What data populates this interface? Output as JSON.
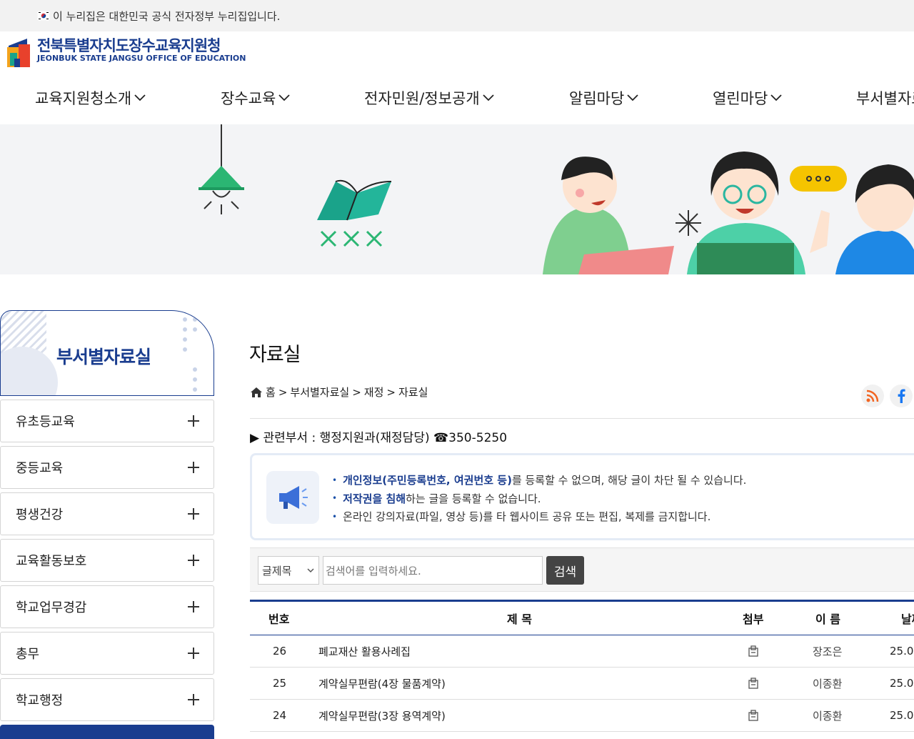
{
  "gov_bar": {
    "text": "이 누리집은 대한민국 공식 전자정부 누리집입니다."
  },
  "logo": {
    "name_ko": "전북특별자치도장수교육지원청",
    "name_en": "JEONBUK STATE JANGSU OFFICE OF EDUCATION"
  },
  "gnb": [
    {
      "label": "교육지원청소개"
    },
    {
      "label": "장수교육"
    },
    {
      "label": "전자민원/정보공개"
    },
    {
      "label": "알림마당"
    },
    {
      "label": "열린마당"
    },
    {
      "label": "부서별자료실"
    }
  ],
  "sidebar": {
    "title": "부서별자료실",
    "items": [
      {
        "label": "유초등교육"
      },
      {
        "label": "중등교육"
      },
      {
        "label": "평생건강"
      },
      {
        "label": "교육활동보호"
      },
      {
        "label": "학교업무경감"
      },
      {
        "label": "총무"
      },
      {
        "label": "학교행정"
      }
    ]
  },
  "content": {
    "title": "자료실",
    "breadcrumb": {
      "home": "홈",
      "level1": "부서별자료실",
      "level2": "재정",
      "current": "자료실",
      "sep": ">"
    },
    "dept": "▶ 관련부서 : 행정지원과(재정담당) ☎350-5250"
  },
  "notice": {
    "line1_strong": "개인정보(주민등록번호, 여권번호 등)",
    "line1_rest": "를 등록할 수 없으며, 해당 글이 차단 될 수 있습니다.",
    "line2_strong": "저작권을 침해",
    "line2_rest": "하는 글을 등록할 수 없습니다.",
    "line3": "온라인 강의자료(파일, 영상 등)를 타 웹사이트 공유 또는 편집, 복제를 금지합니다."
  },
  "search": {
    "select_value": "글제목",
    "placeholder": "검색어를 입력하세요.",
    "button": "검색"
  },
  "table": {
    "headers": {
      "num": "번호",
      "title": "제 목",
      "attach": "첨부",
      "name": "이 름",
      "date": "날짜"
    },
    "rows": [
      {
        "num": "26",
        "title": "폐교재산 활용사례집",
        "name": "장조은",
        "date": "25.0"
      },
      {
        "num": "25",
        "title": "계약실무편람(4장 물품계약)",
        "name": "이종환",
        "date": "25.0"
      },
      {
        "num": "24",
        "title": "계약실무편람(3장 용역계약)",
        "name": "이종환",
        "date": "25.0"
      }
    ]
  },
  "colors": {
    "brand": "#1a3d8f",
    "accent_green": "#2bb673"
  }
}
